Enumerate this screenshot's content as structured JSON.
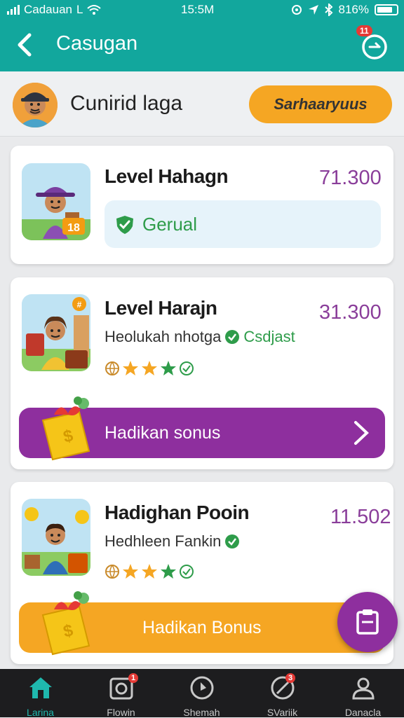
{
  "status_bar": {
    "carrier": "Cadauan",
    "time": "15:5M",
    "battery": "816%",
    "battery_level": 0.82
  },
  "app_bar": {
    "title": "Casugan",
    "timer_badge": "11"
  },
  "user": {
    "name": "Cunirid laga",
    "action_label": "Sarhaaryuus"
  },
  "cards": [
    {
      "title": "Level Hahagn",
      "price": "71.300",
      "status": "Gerual",
      "badge": "18"
    },
    {
      "title": "Level Harajn",
      "price": "31.300",
      "subtitle": "Heolukah nhotga",
      "subtitle_status": "Csdjast",
      "rating": 3,
      "bonus_label": "Hadikan sonus",
      "bonus_color": "#8e2f9e",
      "thumb_badge": "#"
    },
    {
      "title": "Hadighan Pooin",
      "price": "11.502",
      "subtitle": "Hedhleen Fankin",
      "rating": 3,
      "bonus_label": "Hadikan Bonus",
      "bonus_color": "#f5a623"
    }
  ],
  "bottom_nav": [
    {
      "label": "Larina",
      "icon": "home-icon",
      "active": true
    },
    {
      "label": "Flowin",
      "icon": "photo-icon",
      "badge": "1"
    },
    {
      "label": "Shemah",
      "icon": "clock-icon"
    },
    {
      "label": "SVariik",
      "icon": "pen-icon",
      "badge": "3"
    },
    {
      "label": "Danacla",
      "icon": "profile-icon"
    }
  ],
  "colors": {
    "primary": "#12a79d",
    "accent_purple": "#8e2f9e",
    "accent_orange": "#f5a623",
    "success": "#2e9c4a"
  }
}
